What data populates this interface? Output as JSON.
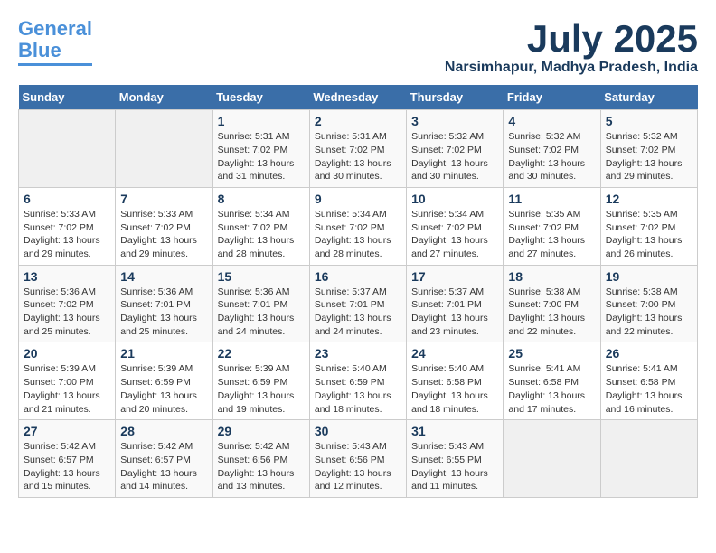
{
  "logo": {
    "line1": "General",
    "line2": "Blue"
  },
  "title": {
    "month_year": "July 2025",
    "location": "Narsimhapur, Madhya Pradesh, India"
  },
  "weekdays": [
    "Sunday",
    "Monday",
    "Tuesday",
    "Wednesday",
    "Thursday",
    "Friday",
    "Saturday"
  ],
  "weeks": [
    [
      {
        "day": "",
        "empty": true
      },
      {
        "day": "",
        "empty": true
      },
      {
        "day": "1",
        "sunrise": "Sunrise: 5:31 AM",
        "sunset": "Sunset: 7:02 PM",
        "daylight": "Daylight: 13 hours and 31 minutes."
      },
      {
        "day": "2",
        "sunrise": "Sunrise: 5:31 AM",
        "sunset": "Sunset: 7:02 PM",
        "daylight": "Daylight: 13 hours and 30 minutes."
      },
      {
        "day": "3",
        "sunrise": "Sunrise: 5:32 AM",
        "sunset": "Sunset: 7:02 PM",
        "daylight": "Daylight: 13 hours and 30 minutes."
      },
      {
        "day": "4",
        "sunrise": "Sunrise: 5:32 AM",
        "sunset": "Sunset: 7:02 PM",
        "daylight": "Daylight: 13 hours and 30 minutes."
      },
      {
        "day": "5",
        "sunrise": "Sunrise: 5:32 AM",
        "sunset": "Sunset: 7:02 PM",
        "daylight": "Daylight: 13 hours and 29 minutes."
      }
    ],
    [
      {
        "day": "6",
        "sunrise": "Sunrise: 5:33 AM",
        "sunset": "Sunset: 7:02 PM",
        "daylight": "Daylight: 13 hours and 29 minutes."
      },
      {
        "day": "7",
        "sunrise": "Sunrise: 5:33 AM",
        "sunset": "Sunset: 7:02 PM",
        "daylight": "Daylight: 13 hours and 29 minutes."
      },
      {
        "day": "8",
        "sunrise": "Sunrise: 5:34 AM",
        "sunset": "Sunset: 7:02 PM",
        "daylight": "Daylight: 13 hours and 28 minutes."
      },
      {
        "day": "9",
        "sunrise": "Sunrise: 5:34 AM",
        "sunset": "Sunset: 7:02 PM",
        "daylight": "Daylight: 13 hours and 28 minutes."
      },
      {
        "day": "10",
        "sunrise": "Sunrise: 5:34 AM",
        "sunset": "Sunset: 7:02 PM",
        "daylight": "Daylight: 13 hours and 27 minutes."
      },
      {
        "day": "11",
        "sunrise": "Sunrise: 5:35 AM",
        "sunset": "Sunset: 7:02 PM",
        "daylight": "Daylight: 13 hours and 27 minutes."
      },
      {
        "day": "12",
        "sunrise": "Sunrise: 5:35 AM",
        "sunset": "Sunset: 7:02 PM",
        "daylight": "Daylight: 13 hours and 26 minutes."
      }
    ],
    [
      {
        "day": "13",
        "sunrise": "Sunrise: 5:36 AM",
        "sunset": "Sunset: 7:02 PM",
        "daylight": "Daylight: 13 hours and 25 minutes."
      },
      {
        "day": "14",
        "sunrise": "Sunrise: 5:36 AM",
        "sunset": "Sunset: 7:01 PM",
        "daylight": "Daylight: 13 hours and 25 minutes."
      },
      {
        "day": "15",
        "sunrise": "Sunrise: 5:36 AM",
        "sunset": "Sunset: 7:01 PM",
        "daylight": "Daylight: 13 hours and 24 minutes."
      },
      {
        "day": "16",
        "sunrise": "Sunrise: 5:37 AM",
        "sunset": "Sunset: 7:01 PM",
        "daylight": "Daylight: 13 hours and 24 minutes."
      },
      {
        "day": "17",
        "sunrise": "Sunrise: 5:37 AM",
        "sunset": "Sunset: 7:01 PM",
        "daylight": "Daylight: 13 hours and 23 minutes."
      },
      {
        "day": "18",
        "sunrise": "Sunrise: 5:38 AM",
        "sunset": "Sunset: 7:00 PM",
        "daylight": "Daylight: 13 hours and 22 minutes."
      },
      {
        "day": "19",
        "sunrise": "Sunrise: 5:38 AM",
        "sunset": "Sunset: 7:00 PM",
        "daylight": "Daylight: 13 hours and 22 minutes."
      }
    ],
    [
      {
        "day": "20",
        "sunrise": "Sunrise: 5:39 AM",
        "sunset": "Sunset: 7:00 PM",
        "daylight": "Daylight: 13 hours and 21 minutes."
      },
      {
        "day": "21",
        "sunrise": "Sunrise: 5:39 AM",
        "sunset": "Sunset: 6:59 PM",
        "daylight": "Daylight: 13 hours and 20 minutes."
      },
      {
        "day": "22",
        "sunrise": "Sunrise: 5:39 AM",
        "sunset": "Sunset: 6:59 PM",
        "daylight": "Daylight: 13 hours and 19 minutes."
      },
      {
        "day": "23",
        "sunrise": "Sunrise: 5:40 AM",
        "sunset": "Sunset: 6:59 PM",
        "daylight": "Daylight: 13 hours and 18 minutes."
      },
      {
        "day": "24",
        "sunrise": "Sunrise: 5:40 AM",
        "sunset": "Sunset: 6:58 PM",
        "daylight": "Daylight: 13 hours and 18 minutes."
      },
      {
        "day": "25",
        "sunrise": "Sunrise: 5:41 AM",
        "sunset": "Sunset: 6:58 PM",
        "daylight": "Daylight: 13 hours and 17 minutes."
      },
      {
        "day": "26",
        "sunrise": "Sunrise: 5:41 AM",
        "sunset": "Sunset: 6:58 PM",
        "daylight": "Daylight: 13 hours and 16 minutes."
      }
    ],
    [
      {
        "day": "27",
        "sunrise": "Sunrise: 5:42 AM",
        "sunset": "Sunset: 6:57 PM",
        "daylight": "Daylight: 13 hours and 15 minutes."
      },
      {
        "day": "28",
        "sunrise": "Sunrise: 5:42 AM",
        "sunset": "Sunset: 6:57 PM",
        "daylight": "Daylight: 13 hours and 14 minutes."
      },
      {
        "day": "29",
        "sunrise": "Sunrise: 5:42 AM",
        "sunset": "Sunset: 6:56 PM",
        "daylight": "Daylight: 13 hours and 13 minutes."
      },
      {
        "day": "30",
        "sunrise": "Sunrise: 5:43 AM",
        "sunset": "Sunset: 6:56 PM",
        "daylight": "Daylight: 13 hours and 12 minutes."
      },
      {
        "day": "31",
        "sunrise": "Sunrise: 5:43 AM",
        "sunset": "Sunset: 6:55 PM",
        "daylight": "Daylight: 13 hours and 11 minutes."
      },
      {
        "day": "",
        "empty": true
      },
      {
        "day": "",
        "empty": true
      }
    ]
  ]
}
